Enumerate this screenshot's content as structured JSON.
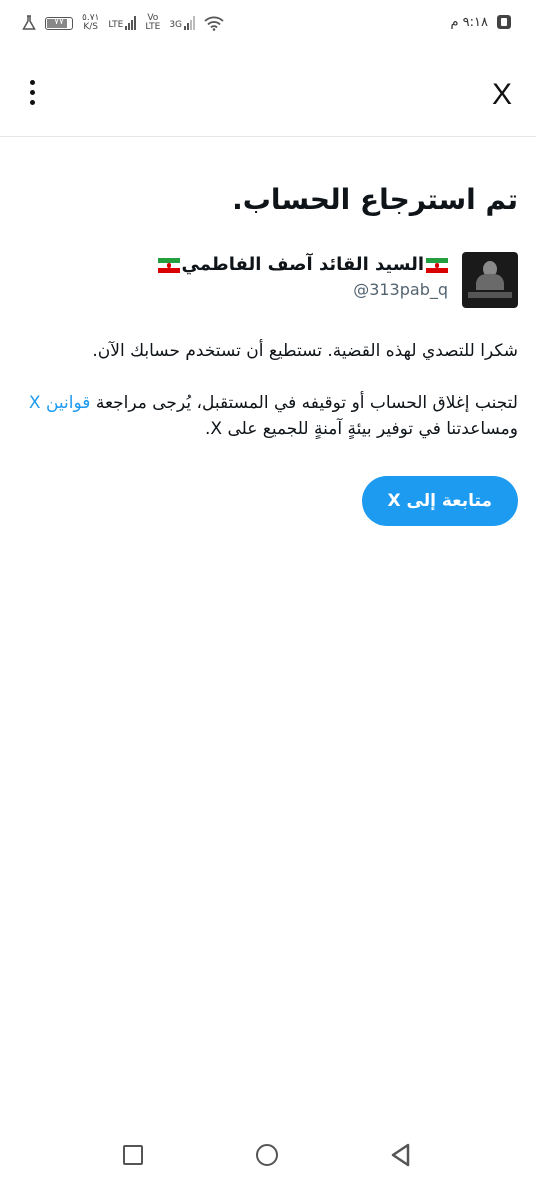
{
  "status_bar": {
    "time": "٩:١٨ م",
    "battery_level": "٧٧",
    "net_speed_value": "٥.٧١",
    "net_speed_unit": "K/S",
    "lte_label": "LTE",
    "volte_top": "Vo",
    "volte_bottom": "LTE",
    "g3_label": "3G"
  },
  "header": {
    "close_label": "X"
  },
  "main": {
    "title": "تم استرجاع الحساب.",
    "account": {
      "name": "السيد القائد آصف الفاطمي",
      "handle": "@313pab_q"
    },
    "paragraph1": "شكرا للتصدي لهذه القضية. تستطيع أن تستخدم حسابك الآن.",
    "paragraph2_before": "لتجنب إغلاق الحساب أو توقيفه في المستقبل، يُرجى مراجعة ",
    "paragraph2_link": "قوانين X",
    "paragraph2_after": " ومساعدتنا في توفير بيئةٍ آمنةٍ للجميع على X.",
    "continue_label": "متابعة إلى X"
  },
  "colors": {
    "accent": "#1d9bf0",
    "text": "#0f1419",
    "secondary_text": "#536471"
  }
}
